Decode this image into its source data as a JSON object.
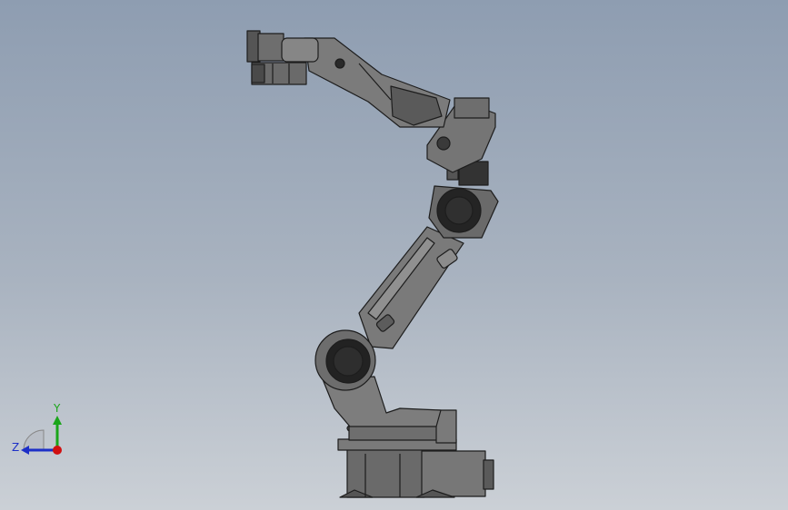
{
  "viewport": {
    "background_top": "#8e9db1",
    "background_bottom": "#cbd0d6"
  },
  "model": {
    "body_color": "#6f6f6f",
    "edge_color": "#1d1d1d",
    "dark_color": "#2b2b2b"
  },
  "triad": {
    "y_label": "Y",
    "z_label": "Z",
    "y_color": "#1aa51a",
    "z_color": "#1c2fc7",
    "x_color": "#d01010"
  }
}
